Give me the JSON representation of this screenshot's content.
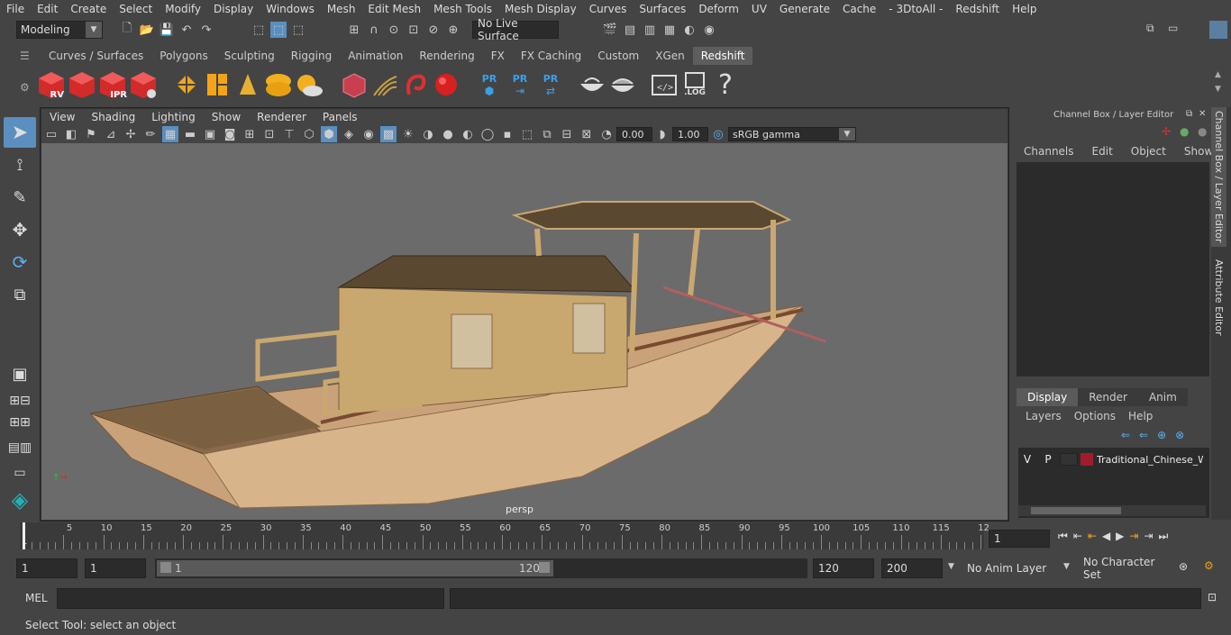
{
  "menubar": [
    "File",
    "Edit",
    "Create",
    "Select",
    "Modify",
    "Display",
    "Windows",
    "Mesh",
    "Edit Mesh",
    "Mesh Tools",
    "Mesh Display",
    "Curves",
    "Surfaces",
    "Deform",
    "UV",
    "Generate",
    "Cache",
    "- 3DtoAll -",
    "Redshift",
    "Help"
  ],
  "statusline": {
    "mode": "Modeling",
    "live_surface": "No Live Surface"
  },
  "shelf_tabs": [
    "Curves / Surfaces",
    "Polygons",
    "Sculpting",
    "Rigging",
    "Animation",
    "Rendering",
    "FX",
    "FX Caching",
    "Custom",
    "XGen",
    "Redshift"
  ],
  "shelf_active": "Redshift",
  "shelf_labels": {
    "rv": "RV",
    "ipr": "IPR",
    "pr1": "PR",
    "pr2": "PR",
    "pr3": "PR",
    "log": ".LOG",
    "help": "?"
  },
  "viewport": {
    "menus": [
      "View",
      "Shading",
      "Lighting",
      "Show",
      "Renderer",
      "Panels"
    ],
    "exposure": "0.00",
    "gamma": "1.00",
    "colorspace": "sRGB gamma",
    "camera": "persp"
  },
  "channel_box": {
    "title": "Channel Box / Layer Editor",
    "menus": [
      "Channels",
      "Edit",
      "Object",
      "Show"
    ],
    "tabs": [
      "Display",
      "Render",
      "Anim"
    ],
    "active_tab": "Display",
    "layer_menus": [
      "Layers",
      "Options",
      "Help"
    ],
    "layer": {
      "v": "V",
      "p": "P",
      "name": "Traditional_Chinese_W",
      "color": "#a01c2c"
    }
  },
  "side_tabs": [
    "Channel Box / Layer Editor",
    "Attribute Editor"
  ],
  "timeline": {
    "ticks": [
      "5",
      "10",
      "15",
      "20",
      "25",
      "30",
      "35",
      "40",
      "45",
      "50",
      "55",
      "60",
      "65",
      "70",
      "75",
      "80",
      "85",
      "90",
      "95",
      "100",
      "105",
      "110",
      "115",
      "12"
    ],
    "start_tick": "1",
    "current_frame": "1"
  },
  "range": {
    "start": "1",
    "playback_start": "1",
    "slider_start": "1",
    "slider_end": "120",
    "playback_end": "120",
    "end": "200",
    "anim_layer": "No Anim Layer",
    "character_set": "No Character Set"
  },
  "mel": {
    "label": "MEL"
  },
  "help_line": "Select Tool: select an object"
}
